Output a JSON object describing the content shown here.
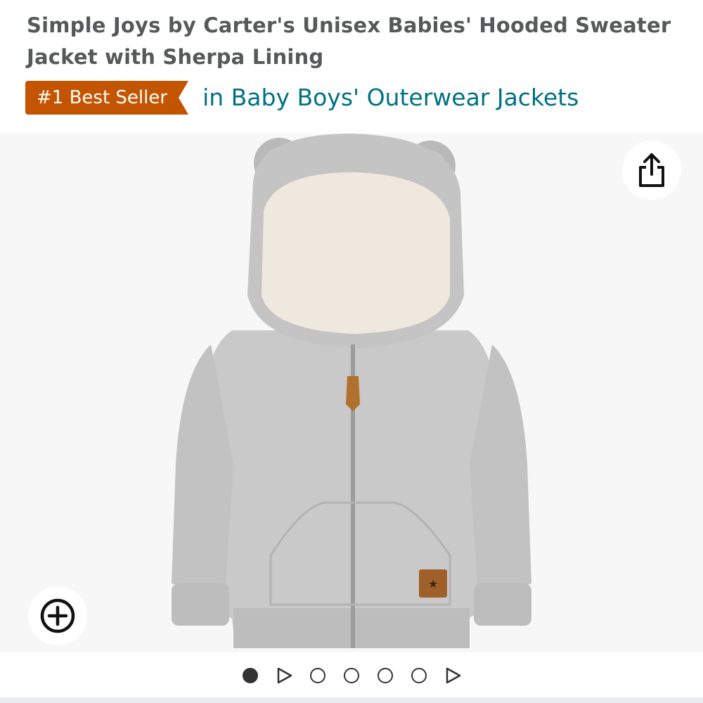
{
  "product": {
    "title": "Simple Joys by Carter's Unisex Babies' Hooded Sweater Jacket with Sherpa Lining"
  },
  "best_seller": {
    "badge": "#1 Best Seller",
    "category": "in Baby Boys' Outerwear Jackets"
  },
  "gallery": {
    "image_icon": "gray-bear-ear-hooded-jacket-image",
    "share_icon": "share-icon",
    "zoom_icon": "zoom-in-icon",
    "indicators": [
      {
        "type": "image",
        "active": true
      },
      {
        "type": "video",
        "active": false
      },
      {
        "type": "image",
        "active": false
      },
      {
        "type": "image",
        "active": false
      },
      {
        "type": "image",
        "active": false
      },
      {
        "type": "image",
        "active": false
      },
      {
        "type": "video",
        "active": false
      }
    ]
  },
  "colors": {
    "badge_bg": "#c45500",
    "category_link": "#007185",
    "title_text": "#565959",
    "gallery_bg": "#f7f7f7"
  }
}
